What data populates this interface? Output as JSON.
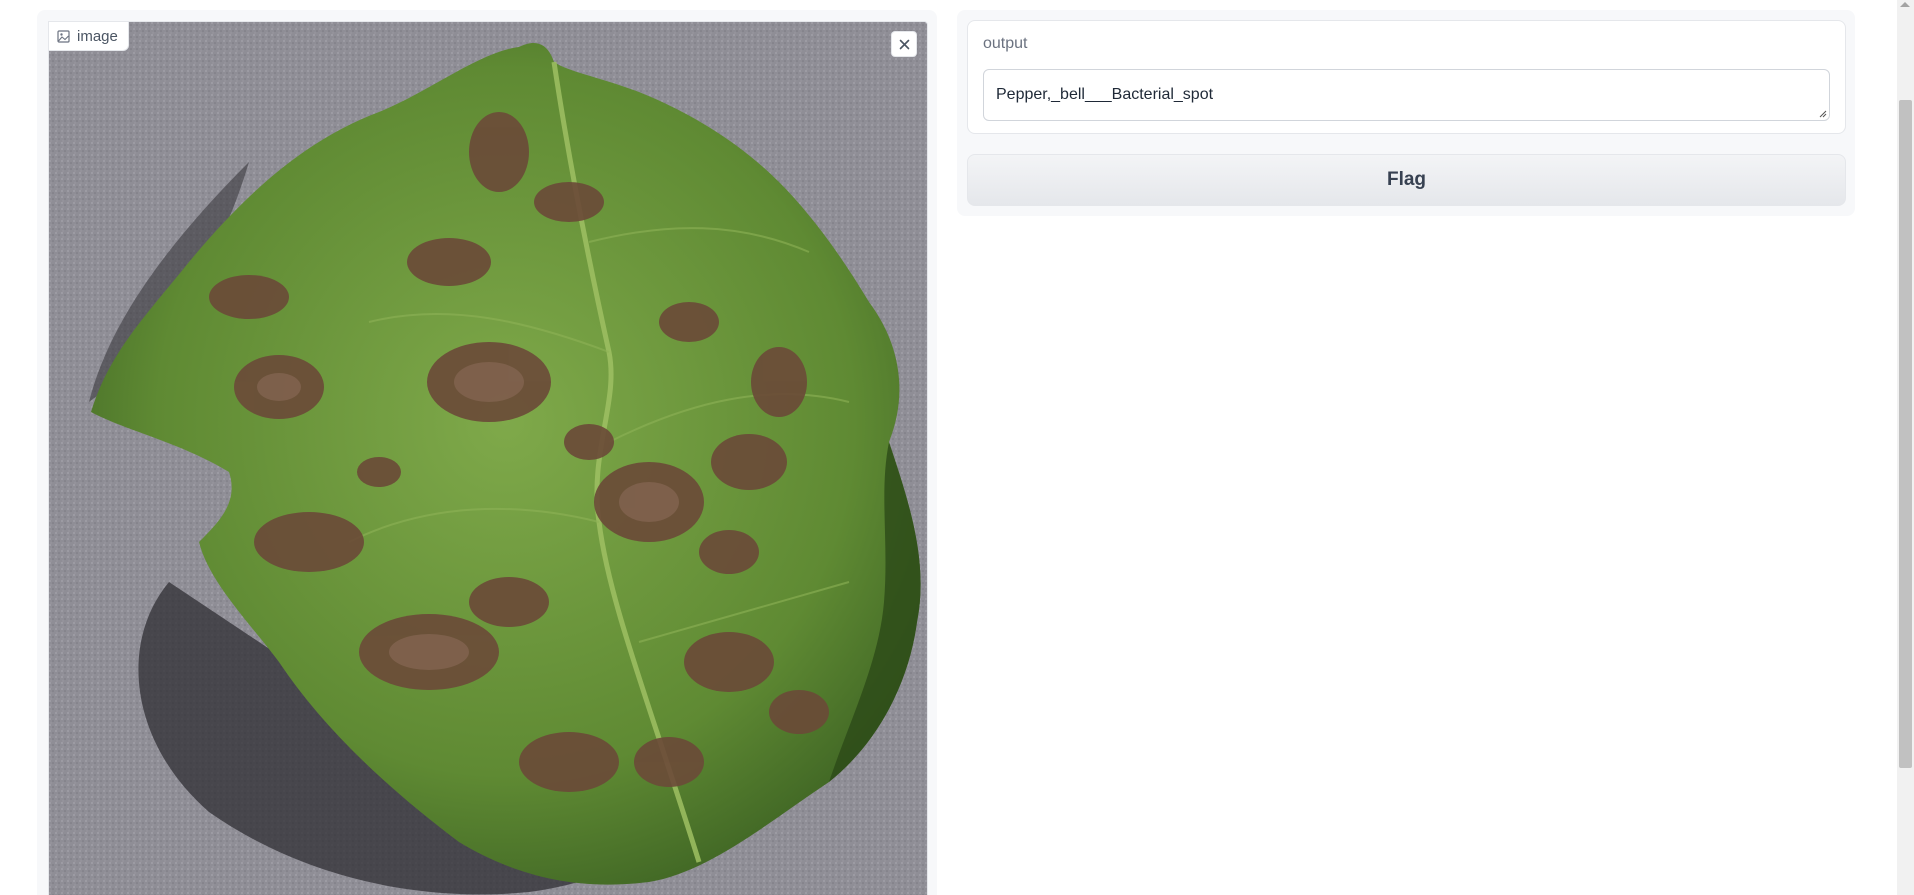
{
  "image_input": {
    "label": "image",
    "label_icon": "image-icon",
    "clear_icon": "close-icon"
  },
  "output": {
    "label": "output",
    "value": "Pepper,_bell___Bacterial_spot"
  },
  "actions": {
    "flag_label": "Flag"
  },
  "colors": {
    "panel_bg": "#f7f8fa",
    "border": "#e5e7eb",
    "leaf_green": "#6e9a3a",
    "lesion_brown": "#6b4a38",
    "background_gray": "#8d8c94"
  }
}
